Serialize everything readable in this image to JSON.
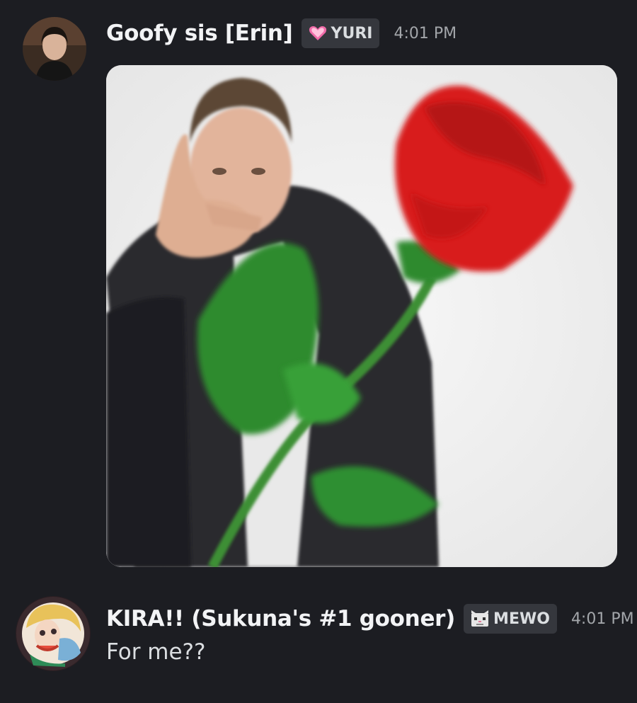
{
  "messages": [
    {
      "author": "Goofy sis [Erin]",
      "tag": {
        "icon": "pink-heart-icon",
        "label": "YURI"
      },
      "timestamp": "4:01 PM",
      "attachment": {
        "type": "image",
        "icon": "man-pointing-with-red-rose-image"
      }
    },
    {
      "author": "KIRA!! (Sukuna's #1 gooner)",
      "tag": {
        "icon": "cat-face-icon",
        "label": "MEWO"
      },
      "timestamp": "4:01 PM",
      "text": "For me??"
    }
  ],
  "colors": {
    "background": "#1c1d22",
    "username": "#f2f3f5",
    "timestamp": "#a3a6aa",
    "tag_bg": "#35373d",
    "rose": "#d81e1e",
    "leaf": "#2e8b2e"
  }
}
